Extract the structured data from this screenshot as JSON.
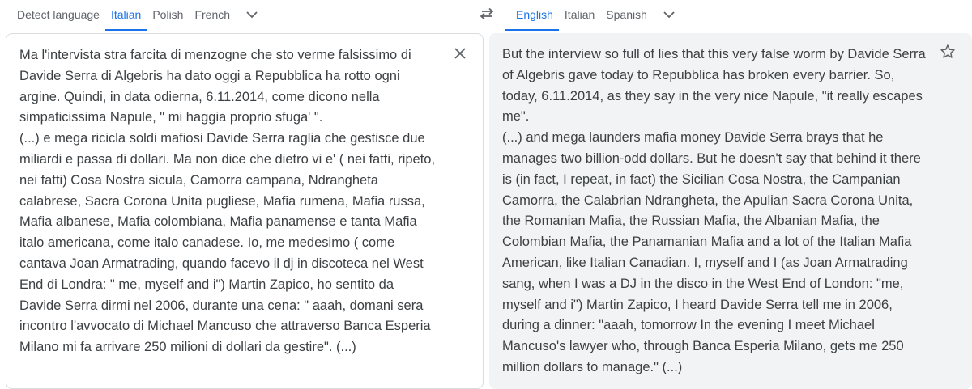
{
  "source_tabs": [
    {
      "label": "Detect language",
      "active": false
    },
    {
      "label": "Italian",
      "active": true
    },
    {
      "label": "Polish",
      "active": false
    },
    {
      "label": "French",
      "active": false
    }
  ],
  "target_tabs": [
    {
      "label": "English",
      "active": true
    },
    {
      "label": "Italian",
      "active": false
    },
    {
      "label": "Spanish",
      "active": false
    }
  ],
  "icons": {
    "more_source": "chevron-down-icon",
    "swap": "swap-languages-icon",
    "more_target": "chevron-down-icon",
    "clear": "close-icon",
    "star": "star-icon"
  },
  "colors": {
    "accent": "#1a73e8",
    "text": "#3c4043",
    "muted": "#5f6368",
    "target_bg": "#f1f3f4",
    "border": "#dadce0"
  },
  "source_text": [
    "Ma l'intervista stra farcita di menzogne che sto verme falsissimo di Davide Serra di Algebris ha dato oggi a Repubblica ha rotto ogni argine. Quindi, in data odierna, 6.11.2014, come dicono nella simpaticissima Napule, \" mi haggia proprio sfuga' \".",
    "(...) e mega ricicla soldi mafiosi Davide Serra raglia che gestisce due miliardi e passa di dollari. Ma non dice che dietro vi e' ( nei fatti, ripeto, nei fatti) Cosa Nostra sicula, Camorra campana, Ndrangheta calabrese, Sacra Corona Unita pugliese, Mafia rumena, Mafia russa, Mafia albanese, Mafia colombiana, Mafia panamense e tanta Mafia italo americana, come italo canadese. Io, me medesimo ( come cantava Joan Armatrading, quando facevo il dj in discoteca nel West End di Londra: \" me, myself and i\") Martin Zapico, ho sentito da Davide Serra dirmi nel 2006, durante una cena: \" aaah, domani sera incontro l'avvocato di Michael Mancuso che attraverso Banca Esperia Milano mi fa arrivare 250 milioni di dollari da gestire\". (...)"
  ],
  "target_text": [
    "But the interview so full of lies that this very false worm by Davide Serra of Algebris gave today to Repubblica has broken every barrier. So, today, 6.11.2014, as they say in the very nice Napule, \"it really escapes me\".",
    "(...) and mega launders mafia money Davide Serra brays that he manages two billion-odd dollars. But he doesn't say that behind it there is (in fact, I repeat, in fact) the Sicilian Cosa Nostra, the Campanian Camorra, the Calabrian Ndrangheta, the Apulian Sacra Corona Unita, the Romanian Mafia, the Russian Mafia, the Albanian Mafia, the Colombian Mafia, the Panamanian Mafia and a lot of the Italian Mafia American, like Italian Canadian. I, myself and I (as Joan Armatrading sang, when I was a DJ in the disco in the West End of London: \"me, myself and i\") Martin Zapico, I heard Davide Serra tell me in 2006, during a dinner: \"aaah, tomorrow In the evening I meet Michael Mancuso's lawyer who, through Banca Esperia Milano, gets me 250 million dollars to manage.\" (...)"
  ]
}
